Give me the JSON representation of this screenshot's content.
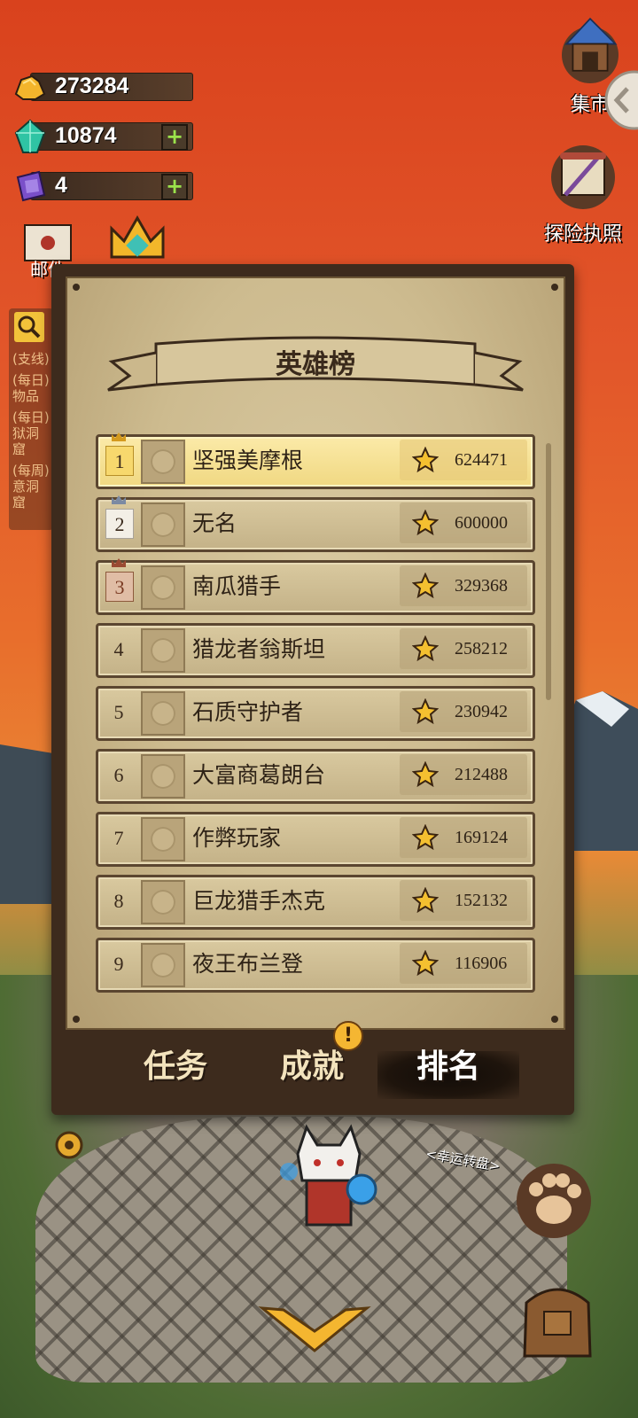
{
  "resources": {
    "gold": "273284",
    "gems": "10874",
    "crystals": "4"
  },
  "right_buttons": {
    "market": "集市",
    "license": "探险执照"
  },
  "left_buttons": {
    "mail": "邮件"
  },
  "quest_list": [
    "(支线)",
    "(每日)物品",
    "(每日)狱洞窟",
    "(每周)意洞窟"
  ],
  "leaderboard": {
    "title": "英雄榜",
    "entries": [
      {
        "rank": "1",
        "name": "坚强美摩根",
        "score": "624471"
      },
      {
        "rank": "2",
        "name": "无名",
        "score": "600000"
      },
      {
        "rank": "3",
        "name": "南瓜猎手",
        "score": "329368"
      },
      {
        "rank": "4",
        "name": "猎龙者翁斯坦",
        "score": "258212"
      },
      {
        "rank": "5",
        "name": "石质守护者",
        "score": "230942"
      },
      {
        "rank": "6",
        "name": "大富商葛朗台",
        "score": "212488"
      },
      {
        "rank": "7",
        "name": "作弊玩家",
        "score": "169124"
      },
      {
        "rank": "8",
        "name": "巨龙猎手杰克",
        "score": "152132"
      },
      {
        "rank": "9",
        "name": "夜王布兰登",
        "score": "116906"
      }
    ]
  },
  "tabs": {
    "tasks": "任务",
    "achievements": "成就",
    "ranking": "排名",
    "achievements_badge": "!"
  },
  "map": {
    "lucky_wheel": "<幸运转盘>"
  },
  "colors": {
    "sky": "#d9421d",
    "panel": "#3d2b1d",
    "paper": "#d8c8a0",
    "highlight_row": "#fbeaa8"
  }
}
